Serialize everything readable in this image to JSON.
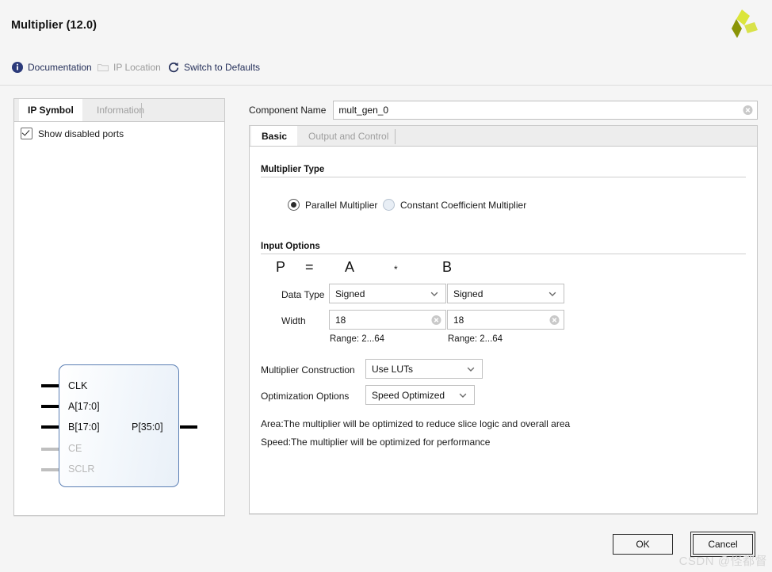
{
  "window": {
    "title": "Multiplier (12.0)",
    "logo_icon": "amd-xilinx-logo-icon",
    "logo_colors": [
      "#c8d400",
      "#e2ea3c",
      "#8a9406"
    ]
  },
  "toolbar": {
    "items": [
      {
        "label": "Documentation",
        "icon": "info-icon",
        "disabled": false
      },
      {
        "label": "IP Location",
        "icon": "folder-icon",
        "disabled": true
      },
      {
        "label": "Switch to Defaults",
        "icon": "refresh-icon",
        "disabled": false
      }
    ]
  },
  "left_panel": {
    "tabs": [
      {
        "label": "IP Symbol",
        "active": true
      },
      {
        "label": "Information",
        "active": false
      }
    ],
    "show_disabled_ports": {
      "label": "Show disabled ports",
      "checked": true
    },
    "symbol": {
      "inputs": [
        {
          "label": "CLK",
          "enabled": true
        },
        {
          "label": "A[17:0]",
          "enabled": true
        },
        {
          "label": "B[17:0]",
          "enabled": true
        },
        {
          "label": "CE",
          "enabled": false
        },
        {
          "label": "SCLR",
          "enabled": false
        }
      ],
      "outputs": [
        {
          "label": "P[35:0]",
          "enabled": true
        }
      ]
    }
  },
  "component_name": {
    "label": "Component Name",
    "value": "mult_gen_0",
    "clear_icon": "clear-circle-icon"
  },
  "tabs": [
    {
      "label": "Basic",
      "active": true
    },
    {
      "label": "Output and Control",
      "active": false
    }
  ],
  "basic": {
    "multiplier_type": {
      "heading": "Multiplier Type",
      "options": [
        {
          "label": "Parallel Multiplier",
          "selected": true
        },
        {
          "label": "Constant Coefficient Multiplier",
          "selected": false
        }
      ]
    },
    "input_options": {
      "heading": "Input Options",
      "formula": {
        "p": "P",
        "equals": "=",
        "a": "A",
        "times": "*",
        "b": "B"
      },
      "data_type_label": "Data Type",
      "width_label": "Width",
      "operand_a": {
        "data_type": "Signed",
        "width": "18",
        "range": "Range: 2...64"
      },
      "operand_b": {
        "data_type": "Signed",
        "width": "18",
        "range": "Range: 2...64"
      }
    },
    "multiplier_construction": {
      "label": "Multiplier Construction",
      "value": "Use LUTs"
    },
    "optimization_options": {
      "label": "Optimization Options",
      "value": "Speed Optimized"
    },
    "notes": [
      "Area:The multiplier will be optimized to reduce slice logic and overall area",
      "Speed:The multiplier will be optimized for performance"
    ]
  },
  "footer": {
    "ok_label": "OK",
    "cancel_label": "Cancel"
  },
  "watermark": "CSDN @怪都督"
}
